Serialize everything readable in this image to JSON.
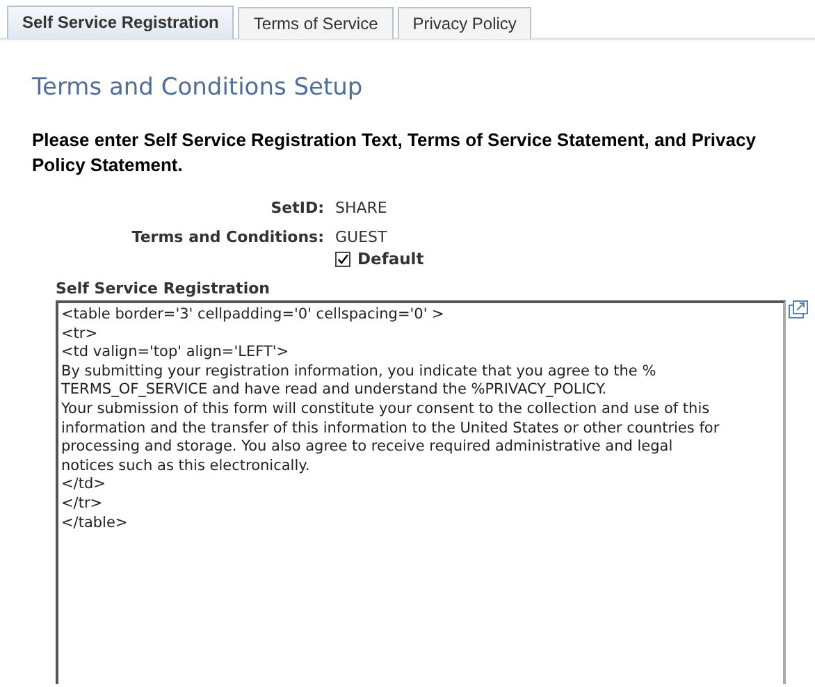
{
  "tabs": [
    {
      "label": "Self Service Registration",
      "selected": true
    },
    {
      "label": "Terms of Service",
      "selected": false
    },
    {
      "label": "Privacy Policy",
      "selected": false
    }
  ],
  "page_title": "Terms and Conditions Setup",
  "instructions": "Please enter Self Service Registration Text, Terms of Service Statement, and Privacy Policy Statement.",
  "fields": [
    {
      "label": "SetID:",
      "value": "SHARE"
    },
    {
      "label": "Terms and Conditions:",
      "value": "GUEST"
    }
  ],
  "default_checkbox": {
    "label": "Default",
    "checked": true
  },
  "editor": {
    "label": "Self Service Registration",
    "lines": [
      "<table border='3' cellpadding='0' cellspacing='0' >",
      "<tr>",
      "<td valign='top' align='LEFT'>",
      "By submitting your registration information, you indicate that you agree to the %",
      "TERMS_OF_SERVICE and have read and understand the %PRIVACY_POLICY.",
      "Your submission of this form will constitute your consent to the collection and use of this",
      "information and the transfer of this information to the United States or other countries for",
      "processing and storage. You also agree to receive required administrative and legal",
      "notices such as this electronically.",
      "</td>",
      "</tr>",
      "</table>"
    ]
  }
}
